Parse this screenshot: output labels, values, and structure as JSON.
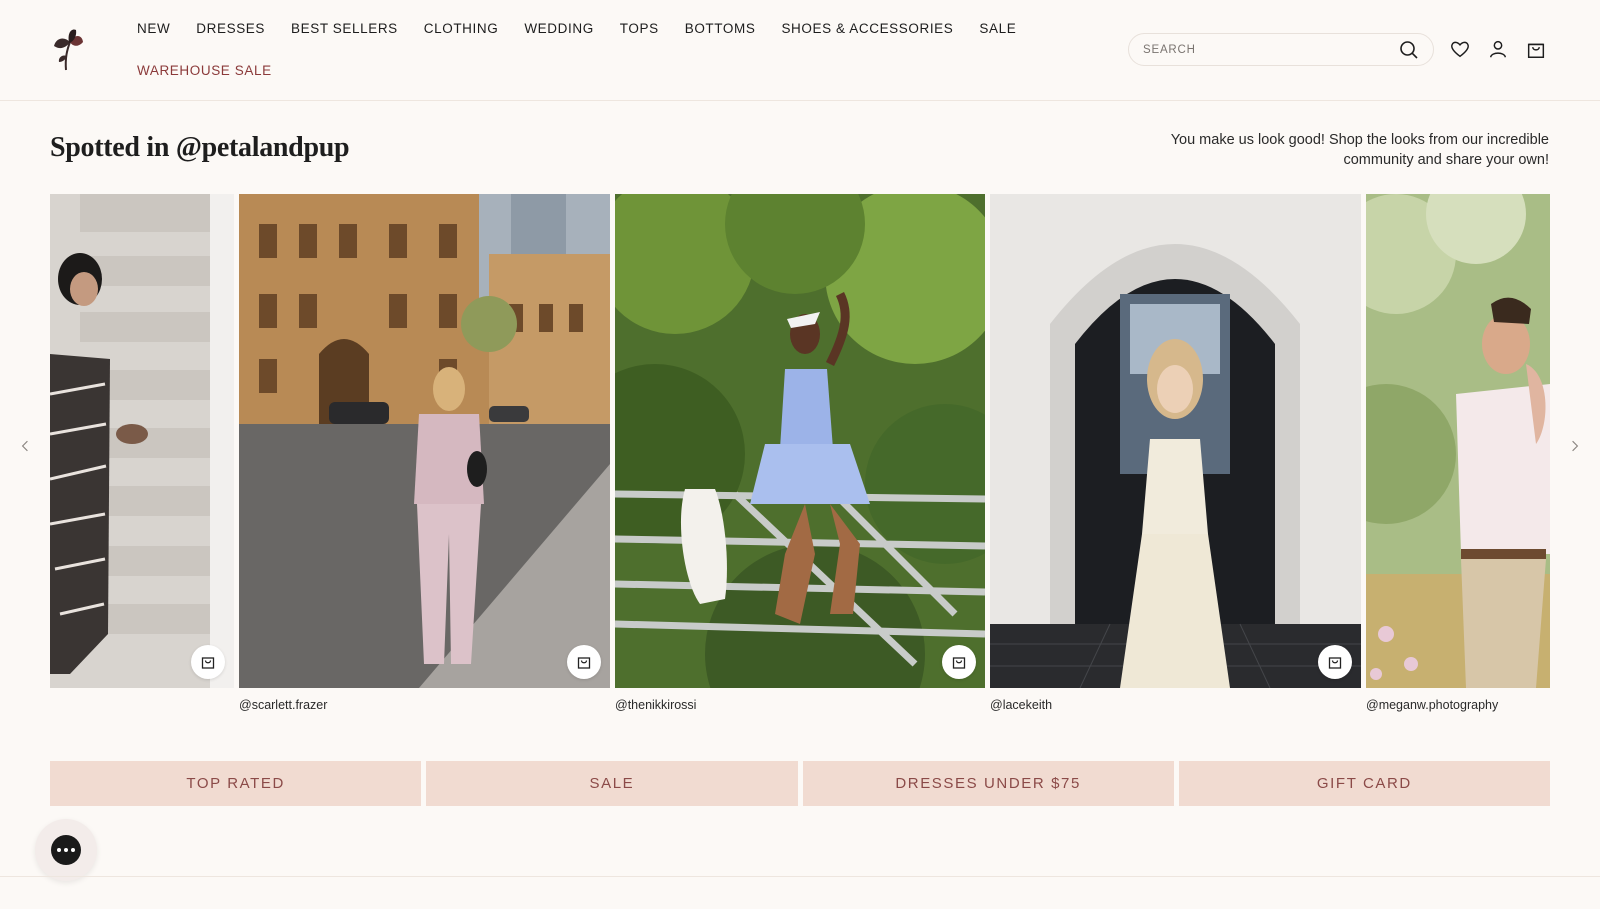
{
  "header": {
    "nav_row1": [
      "NEW",
      "DRESSES",
      "BEST SELLERS",
      "CLOTHING",
      "WEDDING",
      "TOPS",
      "BOTTOMS",
      "SHOES & ACCESSORIES",
      "SALE"
    ],
    "nav_row2": [
      "WAREHOUSE SALE"
    ],
    "search_placeholder": "SEARCH",
    "icons": [
      "search-icon",
      "heart-icon",
      "user-icon",
      "bag-icon"
    ]
  },
  "section": {
    "title": "Spotted in @petalandpup",
    "subtitle": "You make us look good! Shop the looks from our incredible community and share your own!"
  },
  "gallery": {
    "cards": [
      {
        "handle": ""
      },
      {
        "handle": "@scarlett.frazer"
      },
      {
        "handle": "@thenikkirossi"
      },
      {
        "handle": "@lacekeith"
      },
      {
        "handle": "@meganw.photography"
      }
    ]
  },
  "promos": [
    "TOP RATED",
    "SALE",
    "DRESSES UNDER $75",
    "GIFT CARD"
  ],
  "colors": {
    "background": "#fcf9f6",
    "promo_bg": "#f1dbd1",
    "promo_text": "#8b4a48",
    "accent_red": "#8b3a3a"
  }
}
